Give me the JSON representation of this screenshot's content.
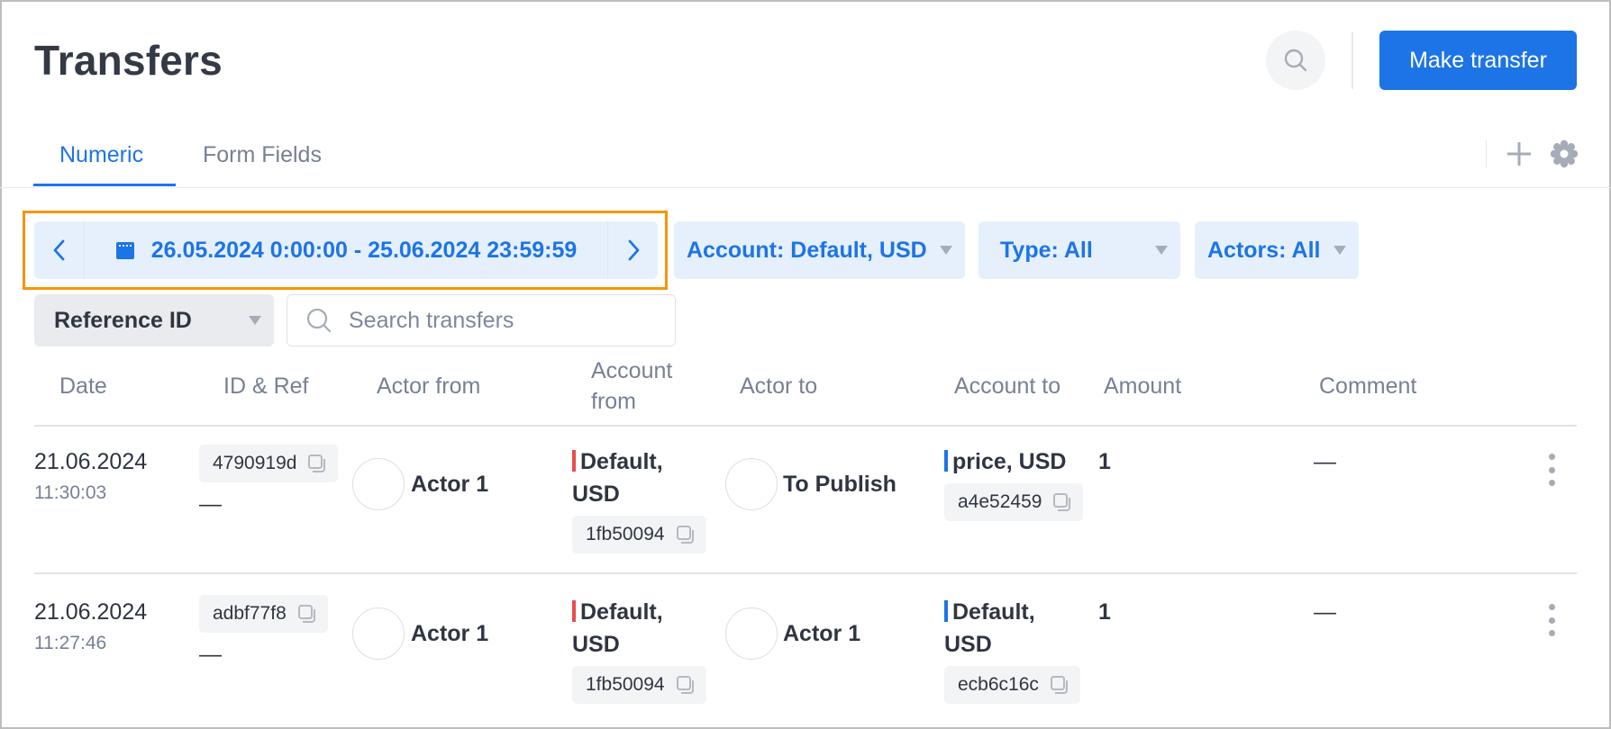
{
  "header": {
    "title": "Transfers",
    "search_icon": "search-icon",
    "make_transfer_label": "Make transfer"
  },
  "tabs": [
    {
      "label": "Numeric",
      "active": true
    },
    {
      "label": "Form Fields",
      "active": false
    }
  ],
  "tab_actions": {
    "add_icon": "plus-icon",
    "settings_icon": "gear-icon"
  },
  "filters": {
    "date_range": "26.05.2024 0:00:00 - 25.06.2024 23:59:59",
    "prev_icon": "chevron-left-icon",
    "next_icon": "chevron-right-icon",
    "calendar_icon": "calendar-icon",
    "account": "Account: Default, USD",
    "type": "Type: All",
    "actors": "Actors: All",
    "search_field": "Reference ID",
    "search_placeholder": "Search transfers",
    "search_value": ""
  },
  "table": {
    "columns": [
      "Date",
      "ID & Ref",
      "Actor from",
      "Account from",
      "Actor to",
      "Account to",
      "Amount",
      "Comment"
    ],
    "rows": [
      {
        "date": "21.06.2024",
        "time": "11:30:03",
        "id": "4790919d",
        "ref": "—",
        "actor_from": "Actor 1",
        "account_from_name": "Default, USD",
        "account_from_id": "1fb50094",
        "actor_to": "To Publish",
        "account_to_name": "price, USD",
        "account_to_id": "a4e52459",
        "amount": "1",
        "comment": "—"
      },
      {
        "date": "21.06.2024",
        "time": "11:27:46",
        "id": "adbf77f8",
        "ref": "—",
        "actor_from": "Actor 1",
        "account_from_name": "Default, USD",
        "account_from_id": "1fb50094",
        "actor_to": "Actor 1",
        "account_to_name": "Default, USD",
        "account_to_id": "ecb6c16c",
        "amount": "1",
        "comment": "—"
      }
    ]
  },
  "colors": {
    "accent": "#1d74e7",
    "chip_bg": "#e6f0fd",
    "focus_outline": "#f5960b",
    "account_from_marker": "#ea4b4b",
    "account_to_marker": "#1d74e7"
  }
}
